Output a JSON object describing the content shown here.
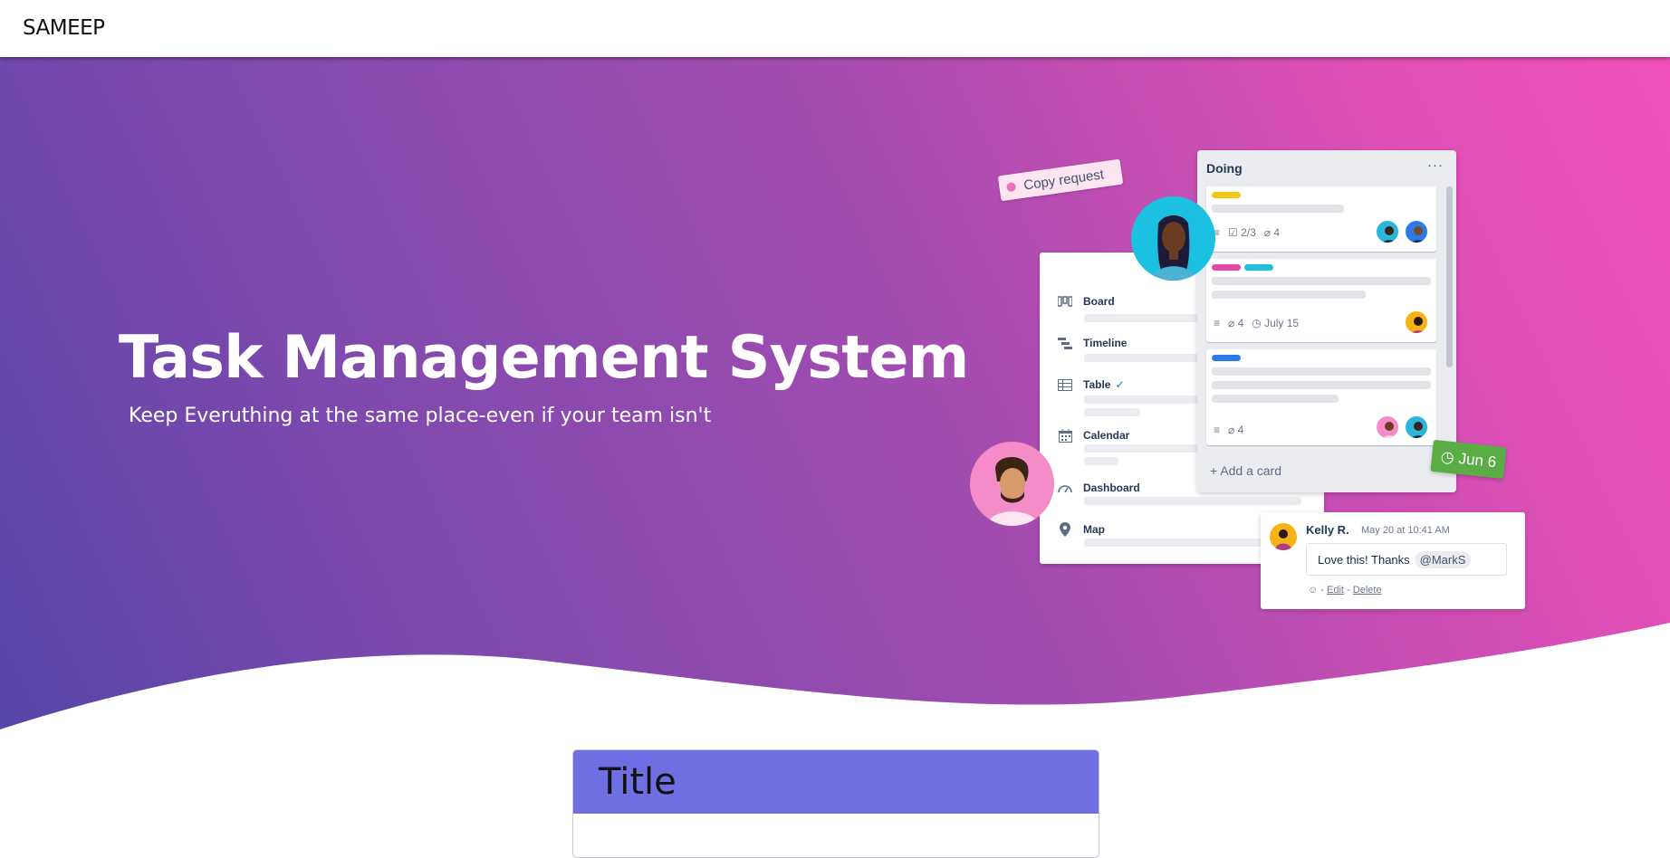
{
  "navbar": {
    "brand": "SAMEEP"
  },
  "hero": {
    "title": "Task Management System",
    "subtitle": "Keep Everuthing at the same place-even if your team isn't"
  },
  "illustration": {
    "copy_tag": "Copy request",
    "views": [
      {
        "label": "Board",
        "icon": "board-icon"
      },
      {
        "label": "Timeline",
        "icon": "timeline-icon"
      },
      {
        "label": "Table",
        "icon": "table-icon",
        "checked": true
      },
      {
        "label": "Calendar",
        "icon": "calendar-icon"
      },
      {
        "label": "Dashboard",
        "icon": "dashboard-icon"
      },
      {
        "label": "Map",
        "icon": "map-pin-icon"
      }
    ],
    "list": {
      "title": "Doing",
      "menu": "···",
      "cards": [
        {
          "checklist": "2/3",
          "attachments": "4"
        },
        {
          "attachments": "4",
          "due": "July 15"
        },
        {
          "attachments": "4"
        }
      ],
      "add_card": "Add a card"
    },
    "due_tag": "Jun 6",
    "comment": {
      "author": "Kelly R.",
      "time": "May 20 at 10:41 AM",
      "text": "Love this! Thanks",
      "mention": "@MarkS",
      "edit": "Edit",
      "delete": "Delete",
      "separator": "-"
    }
  },
  "card_section": {
    "title": "Title"
  },
  "colors": {
    "hero_start": "#5646a8",
    "hero_end": "#f04fb8",
    "card_header": "#6f6ee3",
    "due_green": "#5aac44"
  }
}
